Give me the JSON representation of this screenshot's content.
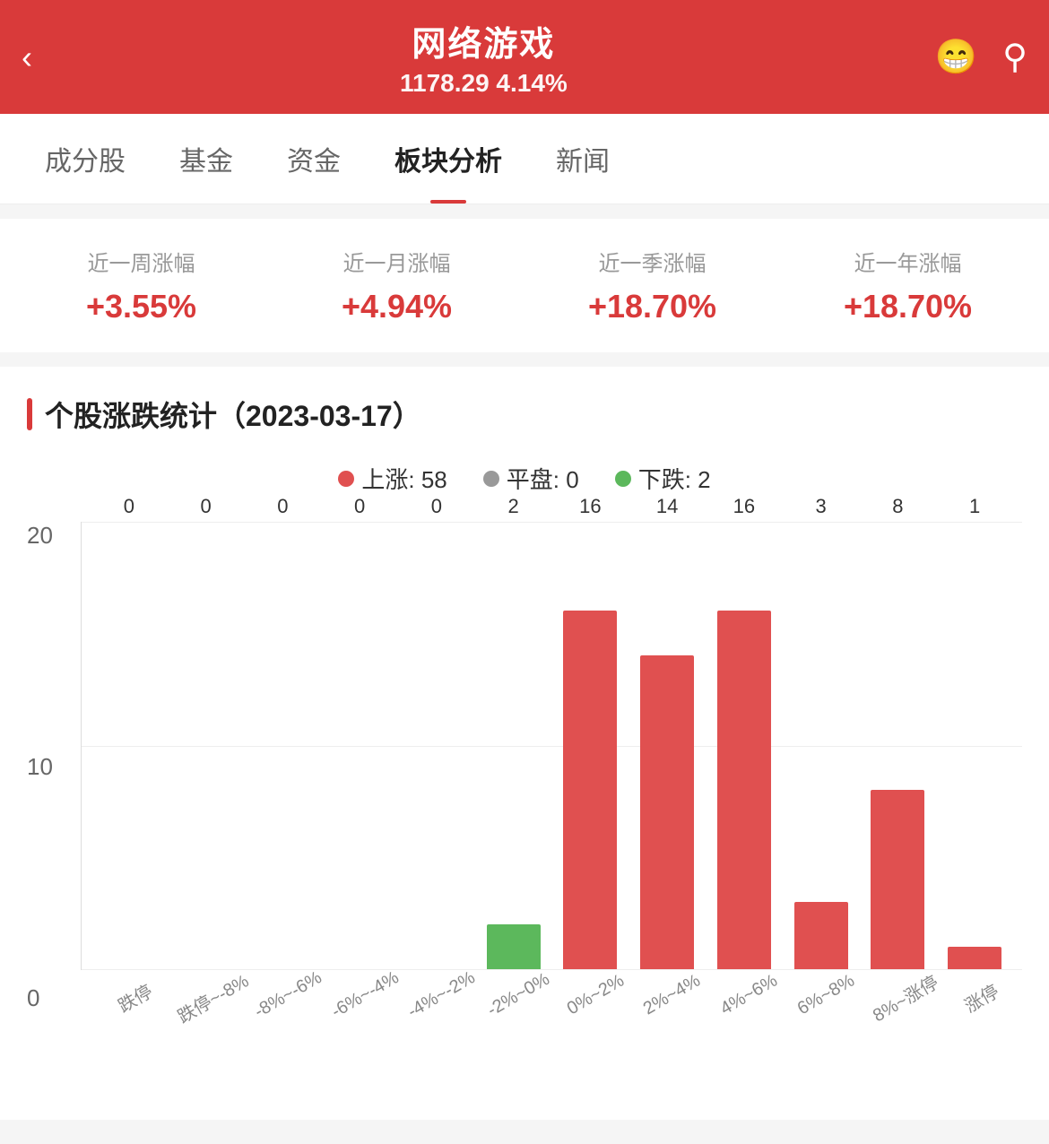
{
  "header": {
    "title": "网络游戏",
    "subtitle": "1178.29 4.14%",
    "back_label": "<",
    "robot_icon": "robot-icon",
    "search_icon": "search-icon"
  },
  "tabs": [
    {
      "id": "chenfen",
      "label": "成分股",
      "active": false
    },
    {
      "id": "jijin",
      "label": "基金",
      "active": false
    },
    {
      "id": "zijin",
      "label": "资金",
      "active": false
    },
    {
      "id": "bankuai",
      "label": "板块分析",
      "active": true
    },
    {
      "id": "xinwen",
      "label": "新闻",
      "active": false
    }
  ],
  "stats": [
    {
      "label": "近一周涨幅",
      "value": "+3.55%"
    },
    {
      "label": "近一月涨幅",
      "value": "+4.94%"
    },
    {
      "label": "近一季涨幅",
      "value": "+18.70%"
    },
    {
      "label": "近一年涨幅",
      "value": "+18.70%"
    }
  ],
  "chart": {
    "section_title": "个股涨跌统计（2023-03-17）",
    "legend": [
      {
        "label": "上涨: 58",
        "color": "#e05050",
        "type": "up"
      },
      {
        "label": "平盘: 0",
        "color": "#999999",
        "type": "flat"
      },
      {
        "label": "下跌: 2",
        "color": "#5cb85c",
        "type": "down"
      }
    ],
    "y_labels": [
      "20",
      "10",
      "0"
    ],
    "bars": [
      {
        "label": "跌停",
        "value": 0,
        "type": "zero"
      },
      {
        "label": "跌停~-8%",
        "value": 0,
        "type": "zero"
      },
      {
        "label": "-8%~-6%",
        "value": 0,
        "type": "zero"
      },
      {
        "label": "-6%~-4%",
        "value": 0,
        "type": "zero"
      },
      {
        "label": "-4%~-2%",
        "value": 0,
        "type": "zero"
      },
      {
        "label": "-2%~0%",
        "value": 2,
        "type": "green"
      },
      {
        "label": "0%~2%",
        "value": 16,
        "type": "red"
      },
      {
        "label": "2%~4%",
        "value": 14,
        "type": "red"
      },
      {
        "label": "4%~6%",
        "value": 16,
        "type": "red"
      },
      {
        "label": "6%~8%",
        "value": 3,
        "type": "red"
      },
      {
        "label": "8%~涨停",
        "value": 8,
        "type": "red"
      },
      {
        "label": "涨停",
        "value": 1,
        "type": "red"
      }
    ],
    "max_value": 20
  }
}
